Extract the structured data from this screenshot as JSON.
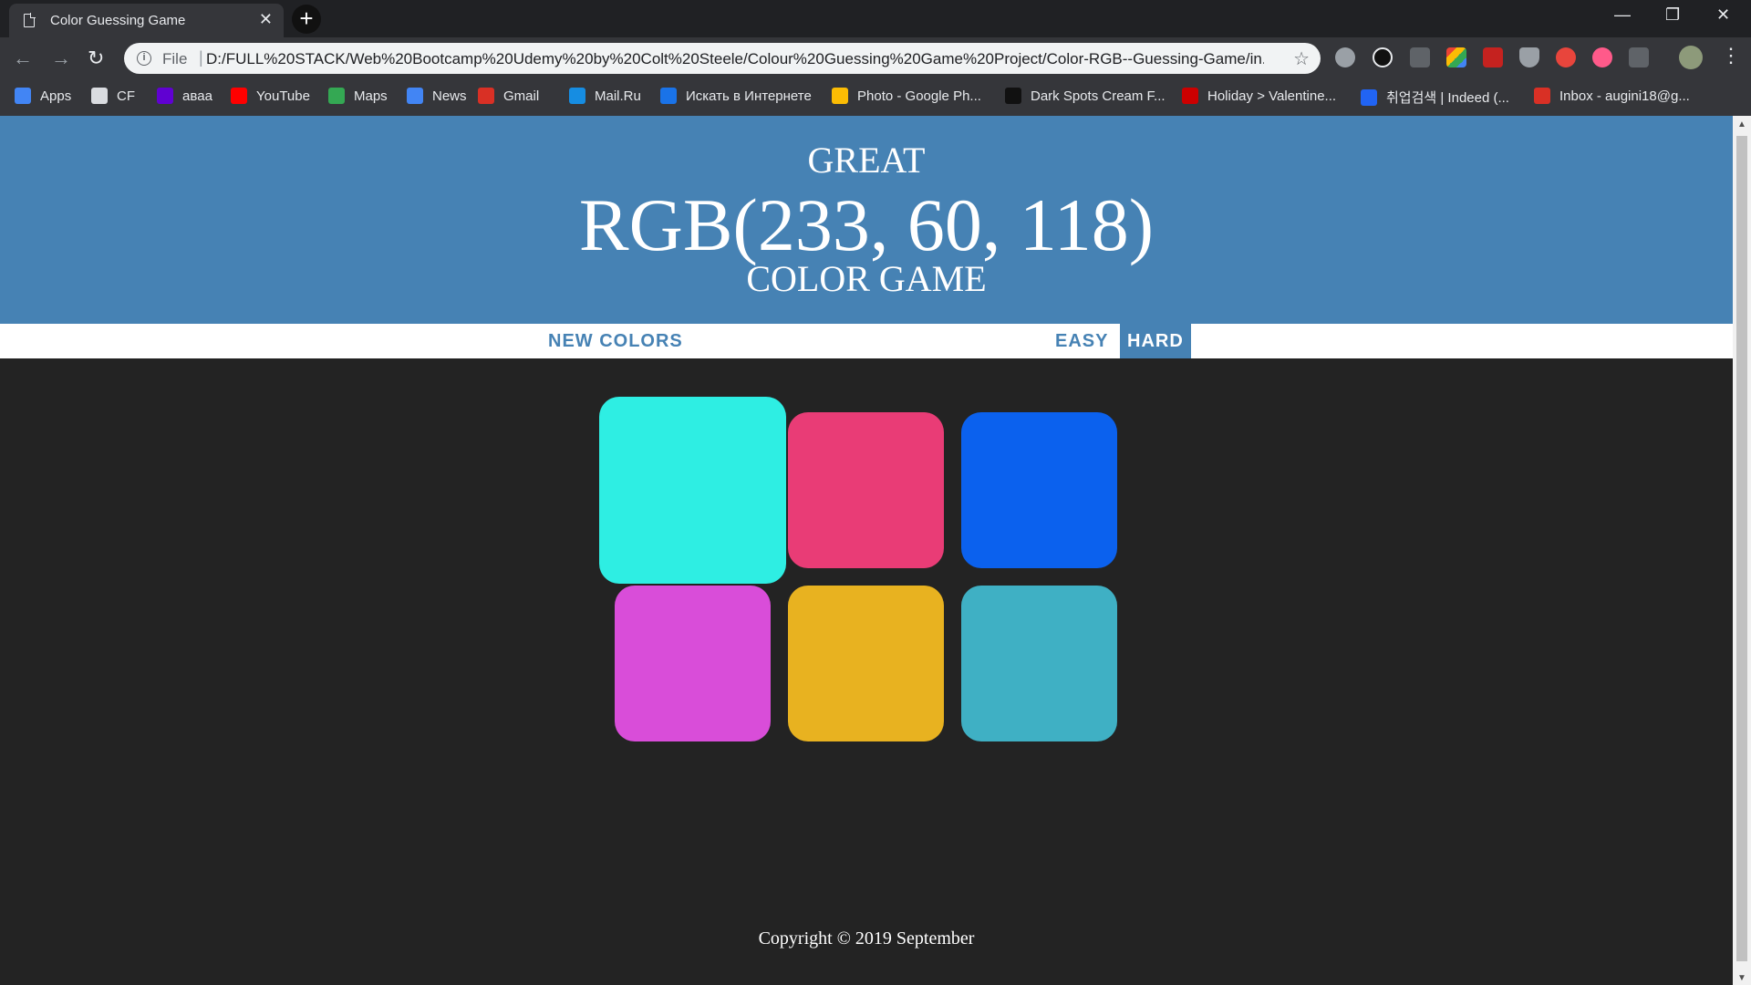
{
  "browser": {
    "tab_title": "Color Guessing Game",
    "url_scheme": "File",
    "url": "D:/FULL%20STACK/Web%20Bootcamp%20Udemy%20by%20Colt%20Steele/Colour%20Guessing%20Game%20Project/Color-RGB--Guessing-Game/in...",
    "bookmarks": [
      {
        "label": "Apps",
        "icon": "apps-grid-icon",
        "color": "#4285f4"
      },
      {
        "label": "CF",
        "icon": "search-icon",
        "color": "#dadce0"
      },
      {
        "label": "авaa",
        "icon": "yahoo-icon",
        "color": "#6001d2"
      },
      {
        "label": "YouTube",
        "icon": "youtube-icon",
        "color": "#ff0000"
      },
      {
        "label": "Maps",
        "icon": "maps-icon",
        "color": "#34a853"
      },
      {
        "label": "News",
        "icon": "news-icon",
        "color": "#4285f4"
      },
      {
        "label": "Gmail",
        "icon": "gmail-icon",
        "color": "#d93025"
      },
      {
        "label": "Mail.Ru",
        "icon": "mailru-icon",
        "color": "#168de2"
      },
      {
        "label": "Искать в Интернете",
        "icon": "search-web-icon",
        "color": "#1a73e8"
      },
      {
        "label": "Photo - Google Ph...",
        "icon": "google-photos-icon",
        "color": "#fbbc04"
      },
      {
        "label": "Dark Spots Cream F...",
        "icon": "dark-spots-icon",
        "color": "#111111"
      },
      {
        "label": "Holiday > Valentine...",
        "icon": "holiday-icon",
        "color": "#cc0000"
      },
      {
        "label": "취업검색 | Indeed (...",
        "icon": "indeed-icon",
        "color": "#2164f3"
      },
      {
        "label": "Inbox - augini18@g...",
        "icon": "gmail-icon",
        "color": "#d93025"
      }
    ]
  },
  "game": {
    "message": "GREAT",
    "rgb_target": "RGB(233, 60, 118)",
    "title": "COLOR GAME",
    "new_colors_label": "NEW COLORS",
    "easy_label": "EASY",
    "hard_label": "HARD",
    "selected_mode": "HARD",
    "header_color": "#4682b4",
    "squares": [
      {
        "color": "#2eeee3",
        "highlighted": true
      },
      {
        "color": "#e93c76",
        "highlighted": false
      },
      {
        "color": "#0b61ee",
        "highlighted": false
      },
      {
        "color": "#d94dd9",
        "highlighted": false
      },
      {
        "color": "#e8b220",
        "highlighted": false
      },
      {
        "color": "#3fb0c4",
        "highlighted": false
      }
    ],
    "footer": "Copyright © 2019 September"
  }
}
